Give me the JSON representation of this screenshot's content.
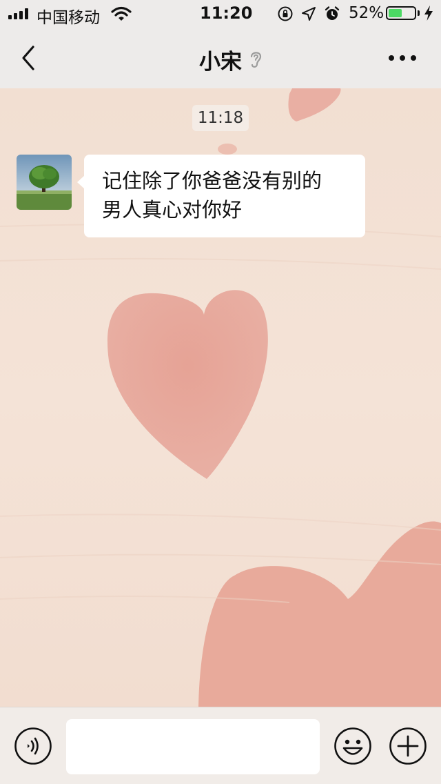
{
  "status_bar": {
    "carrier": "中国移动",
    "time": "11:20",
    "battery_percent": "52%",
    "battery_level": 0.52,
    "icons": [
      "signal-icon",
      "wifi-icon",
      "orientation-lock-icon",
      "location-arrow-icon",
      "alarm-icon",
      "battery-icon",
      "charging-bolt-icon"
    ]
  },
  "nav": {
    "back_icon": "chevron-left-icon",
    "title": "小宋",
    "title_icon": "ear-icon",
    "more_icon": "more-dots-icon"
  },
  "chat": {
    "timestamp": "11:18",
    "messages": [
      {
        "sender_avatar": "tree-landscape-avatar",
        "lines": [
          "记住除了你爸爸没有别的",
          "男人真心对你好"
        ]
      }
    ]
  },
  "input_bar": {
    "value": "",
    "voice_icon": "voice-icon",
    "emoji_icon": "emoji-icon",
    "plus_icon": "plus-circle-icon"
  },
  "colors": {
    "background": "#f3e1d5",
    "heart": "#e5a497",
    "bar": "#edebea",
    "battery_green": "#4cd964",
    "bubble": "#ffffff"
  }
}
